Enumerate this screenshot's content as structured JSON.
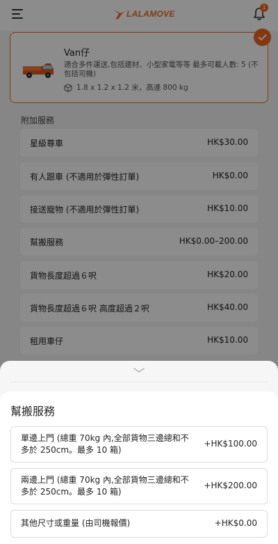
{
  "header": {
    "logo_text": "LALAMOVE",
    "notification_count": "1",
    "brand_color": "#f16622"
  },
  "vehicle": {
    "name": "Van仔",
    "description": "適合多件運送,包括建材、小型家電等等 最多可載人數: 5 (不包括司機)",
    "spec": "1.8 x 1.2 x 1.2 米，高達 800 kg",
    "selected": true
  },
  "addons": {
    "title": "附加服務",
    "items": [
      {
        "name": "星級尊車",
        "price": "HK$30.00"
      },
      {
        "name": "有人跟車 (不適用於彈性訂單)",
        "price": "HK$0.00"
      },
      {
        "name": "接送寵物 (不適用於彈性訂單)",
        "price": "HK$10.00"
      },
      {
        "name": "幫搬服務",
        "price": "HK$0.00–200.00"
      },
      {
        "name": "貨物長度超過６呎",
        "price": "HK$20.00"
      },
      {
        "name": "貨物長度超過６呎 高度超過２呎",
        "price": "HK$40.00"
      },
      {
        "name": "租用車仔",
        "price": "HK$10.00"
      }
    ]
  },
  "sheet": {
    "title": "幫搬服務",
    "options": [
      {
        "line1": "單邊上門 (總重 70kg 內,全部貨物三邊總和不",
        "line2": "多於 250cm。最多 10 箱)",
        "price": "+HK$100.00"
      },
      {
        "line1": "兩邊上門 (總重 70kg 內,全部貨物三邊總和不",
        "line2": "多於 250cm。最多 10 箱)",
        "price": "+HK$200.00"
      },
      {
        "line1": "其他尺寸或重量 (由司機報價)",
        "line2": "",
        "price": "+HK$0.00"
      }
    ]
  },
  "icons": {
    "menu": "menu-icon",
    "bell": "bell-icon",
    "check": "check-icon",
    "van": "van-image",
    "box": "box-icon",
    "sheet_handle": "chevron-down-icon"
  }
}
